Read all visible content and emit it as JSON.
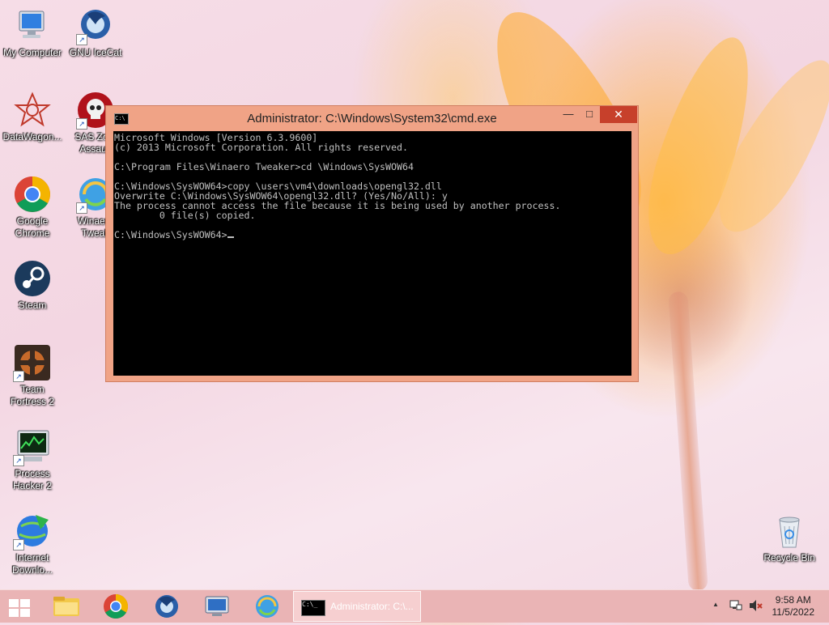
{
  "desktop": {
    "icons": [
      {
        "label": "My Computer"
      },
      {
        "label": "GNU IceCat"
      },
      {
        "label": "DataWagon..."
      },
      {
        "label": "SAS Zom Assault"
      },
      {
        "label": "Google Chrome"
      },
      {
        "label": "Winaero Tweak"
      },
      {
        "label": "Steam"
      },
      {
        "label": "Team Fortress 2"
      },
      {
        "label": "Process Hacker 2"
      },
      {
        "label": "Internet Downlo..."
      },
      {
        "label": "Recycle Bin"
      }
    ]
  },
  "cmd_window": {
    "title": "Administrator: C:\\Windows\\System32\\cmd.exe",
    "icon_text": "C:\\",
    "minimize_glyph": "—",
    "maximize_glyph": "□",
    "close_glyph": "✕",
    "lines": [
      "Microsoft Windows [Version 6.3.9600]",
      "(c) 2013 Microsoft Corporation. All rights reserved.",
      "",
      "C:\\Program Files\\Winaero Tweaker>cd \\Windows\\SysWOW64",
      "",
      "C:\\Windows\\SysWOW64>copy \\users\\vm4\\downloads\\opengl32.dll",
      "Overwrite C:\\Windows\\SysWOW64\\opengl32.dll? (Yes/No/All): y",
      "The process cannot access the file because it is being used by another process.",
      "        0 file(s) copied.",
      ""
    ],
    "prompt": "C:\\Windows\\SysWOW64>"
  },
  "taskbar": {
    "active_task_title": "Administrator: C:\\...",
    "active_task_icon_text": "C:\\_",
    "tray_up_arrow": "▲",
    "time": "9:58 AM",
    "date": "11/5/2022"
  },
  "colors": {
    "title_bar": "#f0a386",
    "close_button": "#c7402b",
    "console_bg": "#000000",
    "console_fg": "#c0c0c0",
    "taskbar": "#e8b0b0"
  }
}
